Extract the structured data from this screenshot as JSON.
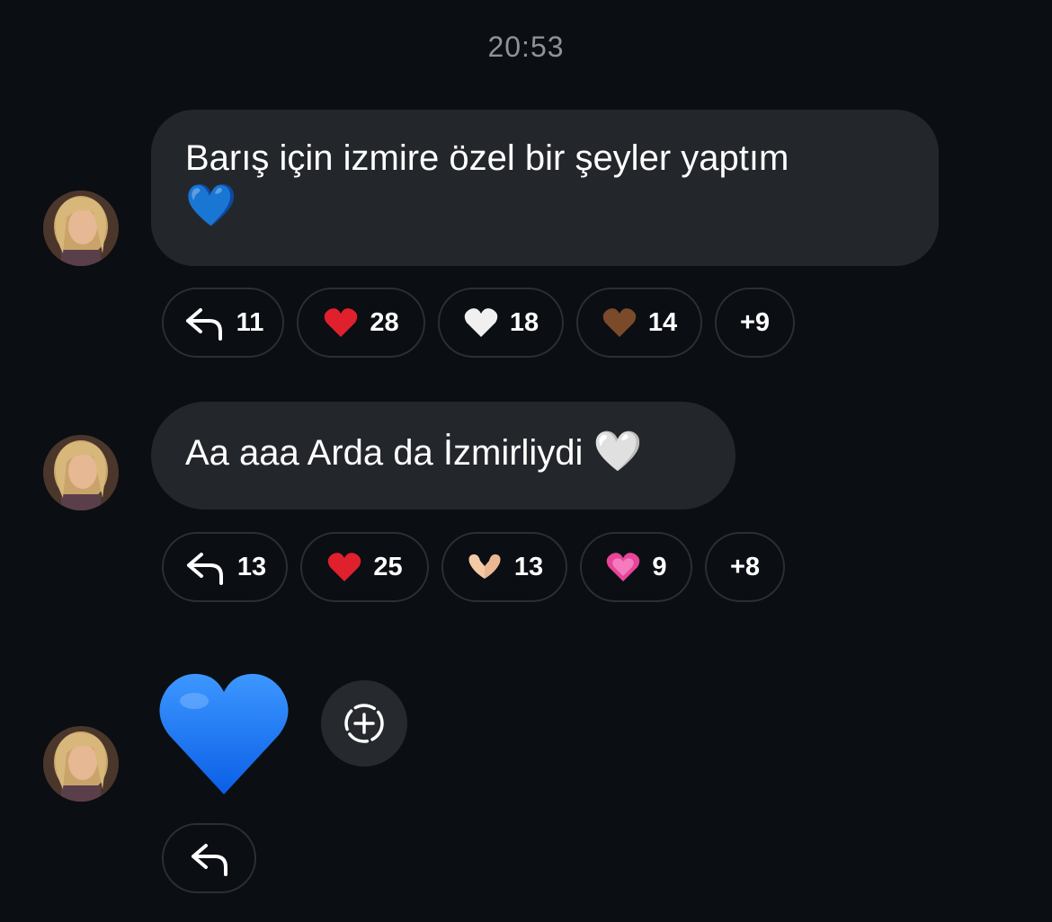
{
  "timestamp": "20:53",
  "messages": [
    {
      "text": "Barış için  izmire özel bir şeyler yaptım",
      "emoji": "💙",
      "reactions": [
        {
          "icon": "reply-icon",
          "count": "11"
        },
        {
          "icon": "red-heart",
          "emoji": "❤",
          "count": "28"
        },
        {
          "icon": "white-heart",
          "emoji": "🤍",
          "count": "18"
        },
        {
          "icon": "brown-heart",
          "emoji": "🤎",
          "count": "14"
        },
        {
          "more": "+9"
        }
      ]
    },
    {
      "text": "Aa aaa Arda da İzmirliydi",
      "emoji": "🤍",
      "reactions": [
        {
          "icon": "reply-icon",
          "count": "13"
        },
        {
          "icon": "red-heart",
          "emoji": "❤",
          "count": "25"
        },
        {
          "icon": "heart-hands",
          "emoji": "🫶",
          "count": "13"
        },
        {
          "icon": "growing-pink-heart",
          "emoji": "💗",
          "count": "9"
        },
        {
          "more": "+8"
        }
      ]
    },
    {
      "emoji": "💙",
      "reactions": [
        {
          "icon": "reply-icon"
        }
      ]
    }
  ],
  "colors": {
    "background": "#0b0e12",
    "bubble": "#23262b",
    "chip_border": "#2b2f35",
    "timestamp": "#8e939a",
    "blue_heart": "#1e7cff",
    "red_heart": "#e0202c",
    "brown_heart": "#7a4a2a",
    "pink_heart": "#e8449a"
  }
}
